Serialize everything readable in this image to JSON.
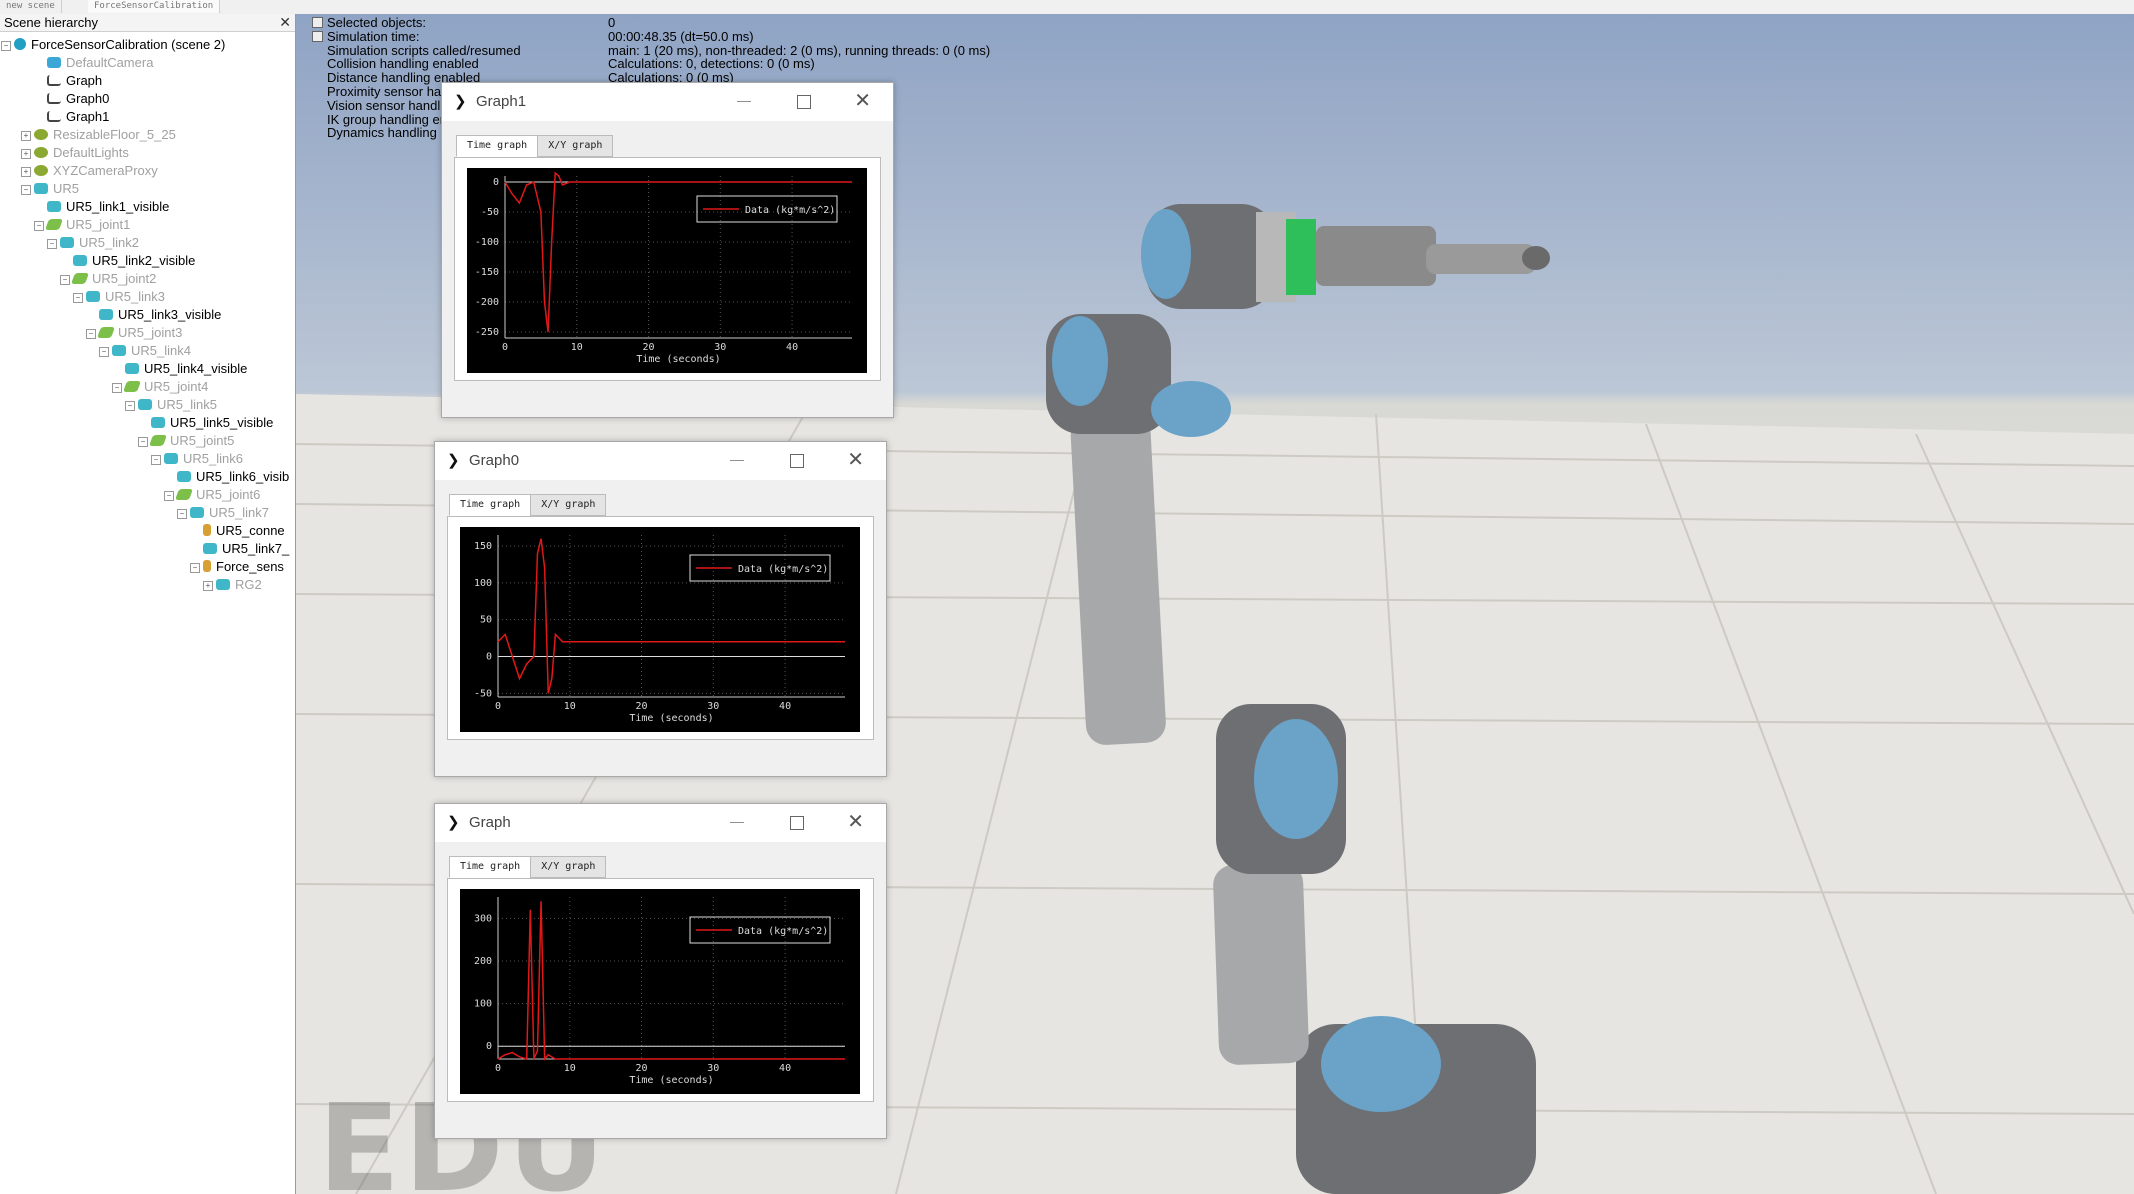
{
  "tabs": [
    "new scene",
    "ForceSensorCalibration"
  ],
  "hierarchy": {
    "title": "Scene hierarchy",
    "close": "✕",
    "items": [
      {
        "label": "ForceSensorCalibration (scene 2)",
        "dim": false,
        "icon": "world"
      },
      {
        "label": "DefaultCamera",
        "dim": true,
        "icon": "cam"
      },
      {
        "label": "Graph",
        "dim": false,
        "icon": "graph"
      },
      {
        "label": "Graph0",
        "dim": false,
        "icon": "graph"
      },
      {
        "label": "Graph1",
        "dim": false,
        "icon": "graph"
      },
      {
        "label": "ResizableFloor_5_25",
        "dim": true,
        "icon": "light"
      },
      {
        "label": "DefaultLights",
        "dim": true,
        "icon": "light"
      },
      {
        "label": "XYZCameraProxy",
        "dim": true,
        "icon": "light"
      },
      {
        "label": "UR5",
        "dim": true,
        "icon": "cyan"
      },
      {
        "label": "UR5_link1_visible",
        "dim": false,
        "icon": "cyan"
      },
      {
        "label": "UR5_joint1",
        "dim": true,
        "icon": "green"
      },
      {
        "label": "UR5_link2",
        "dim": true,
        "icon": "cyan"
      },
      {
        "label": "UR5_link2_visible",
        "dim": false,
        "icon": "cyan"
      },
      {
        "label": "UR5_joint2",
        "dim": true,
        "icon": "green"
      },
      {
        "label": "UR5_link3",
        "dim": true,
        "icon": "cyan"
      },
      {
        "label": "UR5_link3_visible",
        "dim": false,
        "icon": "cyan"
      },
      {
        "label": "UR5_joint3",
        "dim": true,
        "icon": "green"
      },
      {
        "label": "UR5_link4",
        "dim": true,
        "icon": "cyan"
      },
      {
        "label": "UR5_link4_visible",
        "dim": false,
        "icon": "cyan"
      },
      {
        "label": "UR5_joint4",
        "dim": true,
        "icon": "green"
      },
      {
        "label": "UR5_link5",
        "dim": true,
        "icon": "cyan"
      },
      {
        "label": "UR5_link5_visible",
        "dim": false,
        "icon": "cyan"
      },
      {
        "label": "UR5_joint5",
        "dim": true,
        "icon": "green"
      },
      {
        "label": "UR5_link6",
        "dim": true,
        "icon": "cyan"
      },
      {
        "label": "UR5_link6_visib",
        "dim": false,
        "icon": "cyan"
      },
      {
        "label": "UR5_joint6",
        "dim": true,
        "icon": "green"
      },
      {
        "label": "UR5_link7",
        "dim": true,
        "icon": "cyan"
      },
      {
        "label": "UR5_conne",
        "dim": false,
        "icon": "force"
      },
      {
        "label": "UR5_link7_",
        "dim": false,
        "icon": "cyan"
      },
      {
        "label": "Force_sens",
        "dim": false,
        "icon": "force"
      },
      {
        "label": "RG2",
        "dim": true,
        "icon": "cyan"
      }
    ]
  },
  "info": {
    "labels": [
      "Selected objects:",
      "Simulation time:",
      "Simulation scripts called/resumed",
      "Collision handling enabled",
      "Distance handling enabled",
      "Proximity sensor hand",
      "Vision sensor handlin",
      "IK group handling ena",
      "Dynamics handling en"
    ],
    "values": [
      "0",
      "00:00:48.35 (dt=50.0 ms)",
      "main: 1 (20 ms), non-threaded: 2 (0 ms), running threads: 0 (0 ms)",
      "Calculations: 0, detections: 0 (0 ms)",
      "Calculations: 0 (0 ms)"
    ]
  },
  "watermark": "EDU",
  "windows": [
    {
      "title": "Graph1",
      "tab1": "Time graph",
      "tab2": "X/Y graph"
    },
    {
      "title": "Graph0",
      "tab1": "Time graph",
      "tab2": "X/Y graph"
    },
    {
      "title": "Graph",
      "tab1": "Time graph",
      "tab2": "X/Y graph"
    }
  ],
  "chart_data": [
    {
      "type": "line",
      "title": "",
      "xlabel": "Time (seconds)",
      "ylabel": "",
      "xlim": [
        0,
        48.35
      ],
      "ylim": [
        -260,
        10
      ],
      "xticks": [
        0,
        10,
        20,
        30,
        40
      ],
      "yticks": [
        0,
        -50,
        -100,
        -150,
        -200,
        -250
      ],
      "legend": "Data (kg*m/s^2)",
      "legend_position": "top-right",
      "line_color": "#e01818",
      "series": [
        {
          "name": "Data (kg*m/s^2)",
          "x": [
            0,
            1,
            2,
            3,
            4,
            5,
            5.5,
            6,
            6.5,
            7,
            7.5,
            8,
            9,
            10,
            48.35
          ],
          "y": [
            0,
            -20,
            -35,
            -5,
            0,
            -50,
            -200,
            -250,
            -100,
            15,
            10,
            -5,
            0,
            0,
            0
          ]
        }
      ]
    },
    {
      "type": "line",
      "title": "",
      "xlabel": "Time (seconds)",
      "ylabel": "",
      "xlim": [
        0,
        48.35
      ],
      "ylim": [
        -55,
        165
      ],
      "xticks": [
        0,
        10,
        20,
        30,
        40
      ],
      "yticks": [
        150,
        100,
        50,
        0,
        -50
      ],
      "legend": "Data (kg*m/s^2)",
      "legend_position": "top-right",
      "line_color": "#e01818",
      "series": [
        {
          "name": "Data (kg*m/s^2)",
          "x": [
            0,
            1,
            2,
            3,
            4,
            5,
            5.5,
            6,
            6.5,
            7,
            7.5,
            8,
            9,
            10,
            48.35
          ],
          "y": [
            20,
            30,
            0,
            -30,
            -10,
            0,
            140,
            160,
            120,
            -50,
            -30,
            30,
            20,
            20,
            20
          ]
        }
      ]
    },
    {
      "type": "line",
      "title": "",
      "xlabel": "Time (seconds)",
      "ylabel": "",
      "xlim": [
        0,
        48.35
      ],
      "ylim": [
        -30,
        350
      ],
      "xticks": [
        0,
        10,
        20,
        30,
        40
      ],
      "yticks": [
        300,
        200,
        100,
        0
      ],
      "legend": "Data (kg*m/s^2)",
      "legend_position": "top-right",
      "line_color": "#e01818",
      "series": [
        {
          "name": "Data (kg*m/s^2)",
          "x": [
            0,
            1,
            2,
            3,
            4,
            4.5,
            5,
            5.5,
            6,
            6.5,
            7,
            7.5,
            8,
            9,
            10,
            48.35
          ],
          "y": [
            -30,
            -20,
            -15,
            -25,
            -30,
            320,
            -30,
            -10,
            340,
            -30,
            -20,
            -25,
            -30,
            -30,
            -30,
            -30
          ]
        }
      ]
    }
  ]
}
